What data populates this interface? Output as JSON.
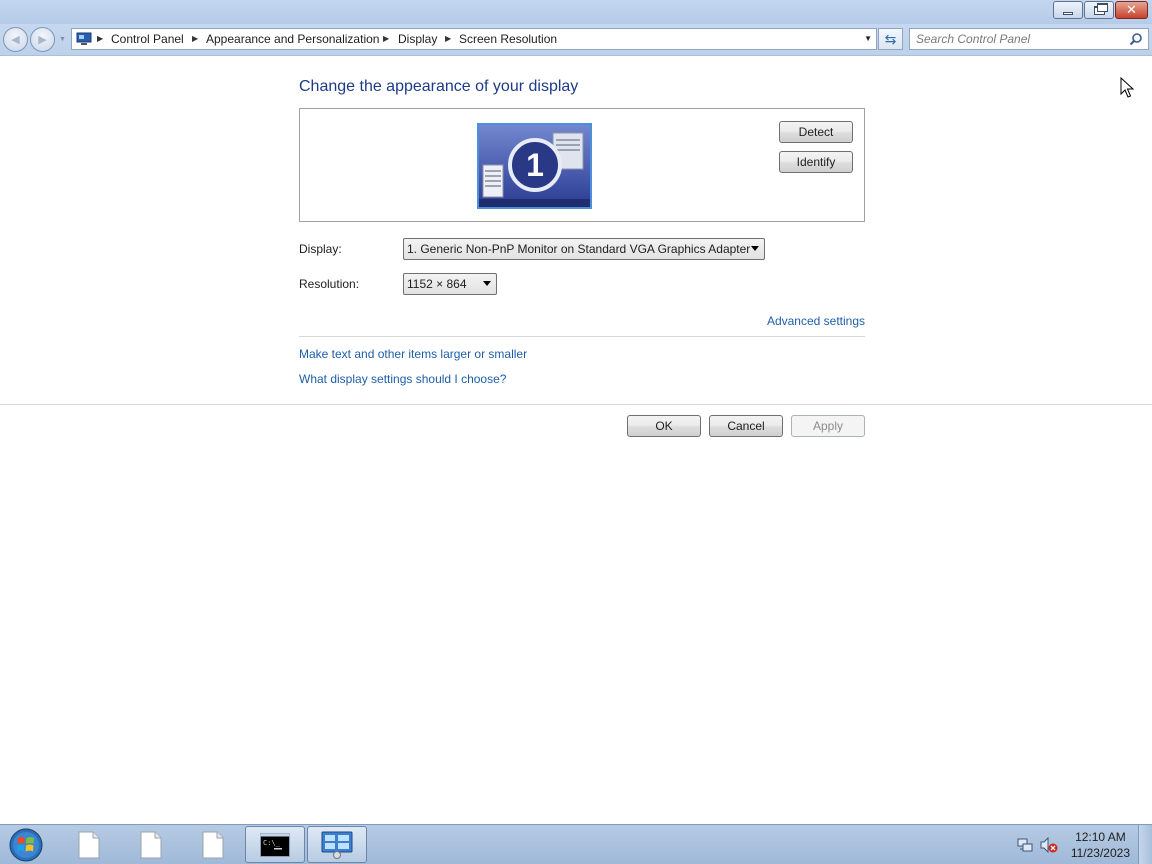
{
  "window": {
    "buttons": {
      "minimize_icon": "minimize-icon",
      "restore_icon": "restore-icon",
      "close_glyph": "✕"
    }
  },
  "navbar": {
    "breadcrumbs": [
      "Control Panel",
      "Appearance and Personalization",
      "Display",
      "Screen Resolution"
    ],
    "search_placeholder": "Search Control Panel"
  },
  "content": {
    "title": "Change the appearance of your display",
    "monitor_number": "1",
    "detect_label": "Detect",
    "identify_label": "Identify",
    "display_label": "Display:",
    "display_value": "1. Generic Non-PnP Monitor on Standard VGA Graphics Adapter",
    "resolution_label": "Resolution:",
    "resolution_value": "1152 × 864",
    "advanced_link": "Advanced settings",
    "links": [
      "Make text and other items larger or smaller",
      "What display settings should I choose?"
    ],
    "ok_label": "OK",
    "cancel_label": "Cancel",
    "apply_label": "Apply",
    "apply_enabled": false
  },
  "taskbar": {
    "items": [
      "document-icon",
      "document-icon",
      "document-icon",
      "command-prompt-icon",
      "control-panel-icon"
    ],
    "active_item": "control-panel-icon",
    "time": "12:10 AM",
    "date": "11/23/2023",
    "tray_icons": [
      "network-icon",
      "volume-muted-icon"
    ]
  },
  "colors": {
    "title_blue": "#1e3b8a",
    "link_blue": "#1e5ea8",
    "frame": "#bdd1ea"
  }
}
